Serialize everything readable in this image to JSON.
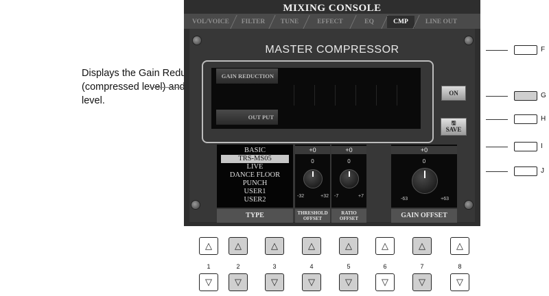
{
  "callout": "Displays the Gain Reduction (compressed level) and output level.",
  "panel": {
    "title": "MIXING CONSOLE",
    "tabs": [
      "VOL/VOICE",
      "FILTER",
      "TUNE",
      "EFFECT",
      "EQ",
      "CMP",
      "LINE OUT"
    ],
    "active_tab": "CMP",
    "compressor_title": "MASTER COMPRESSOR",
    "meter_labels": [
      "GAIN REDUCTION",
      "OUT PUT"
    ],
    "on_label": "ON",
    "save_label": "SAVE",
    "type_list": [
      "BASIC",
      "TRS-MS05",
      "LIVE",
      "DANCE FLOOR",
      "PUNCH",
      "USER1",
      "USER2"
    ],
    "selected_type": "TRS-MS05",
    "threshold": {
      "value": "+0",
      "center": "0",
      "min": "-32",
      "max": "+32",
      "label_line1": "THRESHOLD",
      "label_line2": "OFFSET"
    },
    "ratio": {
      "value": "+0",
      "center": "0",
      "min": "-7",
      "max": "+7",
      "label_line1": "RATIO",
      "label_line2": "OFFSET"
    },
    "gain": {
      "value": "+0",
      "center": "0",
      "min": "-63",
      "max": "+63",
      "label": "GAIN OFFSET"
    },
    "type_footer": "TYPE"
  },
  "side_buttons": [
    "F",
    "G",
    "H",
    "I",
    "J"
  ],
  "bottom_buttons": {
    "numbers": [
      "1",
      "2",
      "3",
      "4",
      "5",
      "6",
      "7",
      "8"
    ],
    "up_glyph": "△",
    "down_glyph": "▽"
  }
}
